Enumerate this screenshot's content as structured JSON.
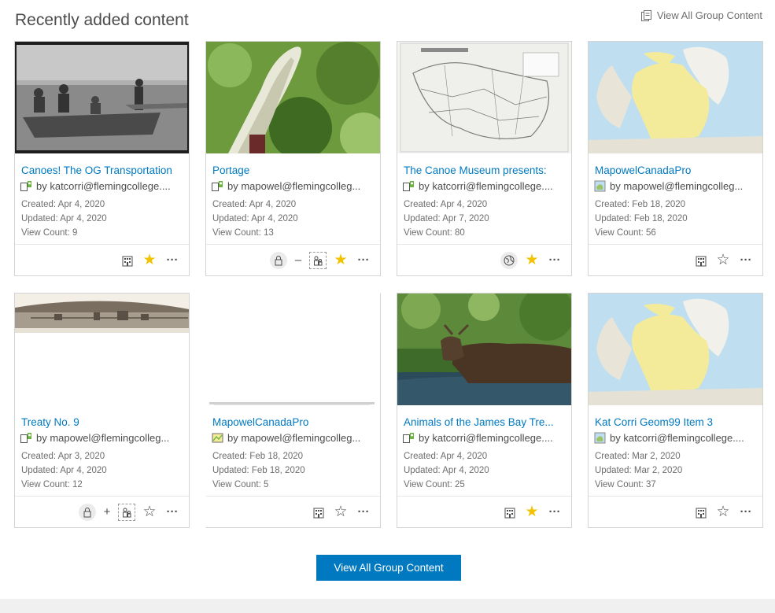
{
  "header": {
    "title": "Recently added content",
    "view_all_link": "View All Group Content"
  },
  "cards": [
    {
      "title": "Canoes! The OG Transportation",
      "owner": "by katcorri@flemingcollege....",
      "created": "Created: Apr 4, 2020",
      "updated": "Updated: Apr 4, 2020",
      "views": "View Count: 9",
      "item_type_icon": "story-map-icon",
      "actions": [
        "building-icon",
        "star-filled-icon",
        "more-icon"
      ]
    },
    {
      "title": "Portage",
      "owner": "by mapowel@flemingcolleg...",
      "created": "Created: Apr 4, 2020",
      "updated": "Updated: Apr 4, 2020",
      "views": "View Count: 13",
      "item_type_icon": "story-map-icon",
      "actions": [
        "lock-icon",
        "minus-icon",
        "share-group-icon",
        "star-filled-icon",
        "more-icon"
      ]
    },
    {
      "title": "The Canoe Museum presents:",
      "owner": "by katcorri@flemingcollege....",
      "created": "Created: Apr 4, 2020",
      "updated": "Updated: Apr 7, 2020",
      "views": "View Count: 80",
      "item_type_icon": "story-map-icon",
      "actions": [
        "globe-icon",
        "star-filled-icon",
        "more-icon"
      ]
    },
    {
      "title": "MapowelCanadaPro",
      "owner": "by mapowel@flemingcolleg...",
      "created": "Created: Feb 18, 2020",
      "updated": "Updated: Feb 18, 2020",
      "views": "View Count: 56",
      "item_type_icon": "web-map-icon",
      "actions": [
        "building-icon",
        "star-outline-icon",
        "more-icon"
      ]
    },
    {
      "title": "Treaty No. 9",
      "owner": "by mapowel@flemingcolleg...",
      "created": "Created: Apr 3, 2020",
      "updated": "Updated: Apr 4, 2020",
      "views": "View Count: 12",
      "item_type_icon": "story-map-icon",
      "actions": [
        "lock-icon",
        "plus-icon",
        "share-group-icon",
        "star-outline-icon",
        "more-icon"
      ]
    },
    {
      "title": "MapowelCanadaPro",
      "owner": "by mapowel@flemingcolleg...",
      "created": "Created: Feb 18, 2020",
      "updated": "Updated: Feb 18, 2020",
      "views": "View Count: 5",
      "item_type_icon": "map-package-icon",
      "actions": [
        "building-icon",
        "star-outline-icon",
        "more-icon"
      ]
    },
    {
      "title": "Animals of the James Bay Tre...",
      "owner": "by katcorri@flemingcollege....",
      "created": "Created: Apr 4, 2020",
      "updated": "Updated: Apr 4, 2020",
      "views": "View Count: 25",
      "item_type_icon": "story-map-icon",
      "actions": [
        "building-icon",
        "star-filled-icon",
        "more-icon"
      ]
    },
    {
      "title": "Kat Corri Geom99 Item 3",
      "owner": "by katcorri@flemingcollege....",
      "created": "Created: Mar 2, 2020",
      "updated": "Updated: Mar 2, 2020",
      "views": "View Count: 37",
      "item_type_icon": "web-map-icon",
      "actions": [
        "building-icon",
        "star-outline-icon",
        "more-icon"
      ]
    }
  ],
  "footer": {
    "button_label": "View All Group Content"
  },
  "colors": {
    "link": "#0079c1",
    "button": "#0079c1",
    "star": "#f2c300"
  }
}
